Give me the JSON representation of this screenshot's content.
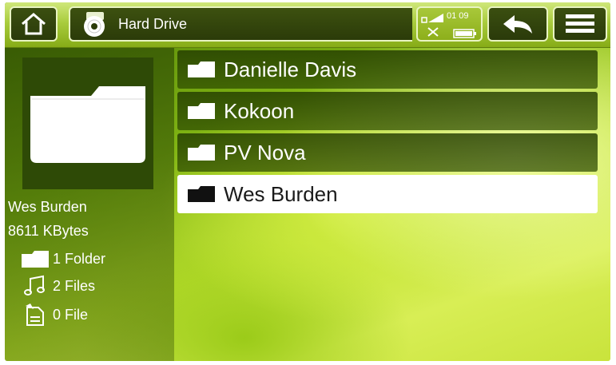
{
  "header": {
    "title": "Hard Drive",
    "time": "01 09"
  },
  "left_panel": {
    "name": "Wes Burden",
    "size": "8611 KBytes",
    "folder_count": "1 Folder",
    "music_count": "2 Files",
    "other_count": "0 File"
  },
  "folders": [
    {
      "label": "Danielle Davis",
      "selected": false
    },
    {
      "label": "Kokoon",
      "selected": false
    },
    {
      "label": "PV Nova",
      "selected": false
    },
    {
      "label": "Wes Burden",
      "selected": true
    }
  ],
  "colors": {
    "accent": "#8daf1b",
    "selected_bg": "#ffffff"
  }
}
